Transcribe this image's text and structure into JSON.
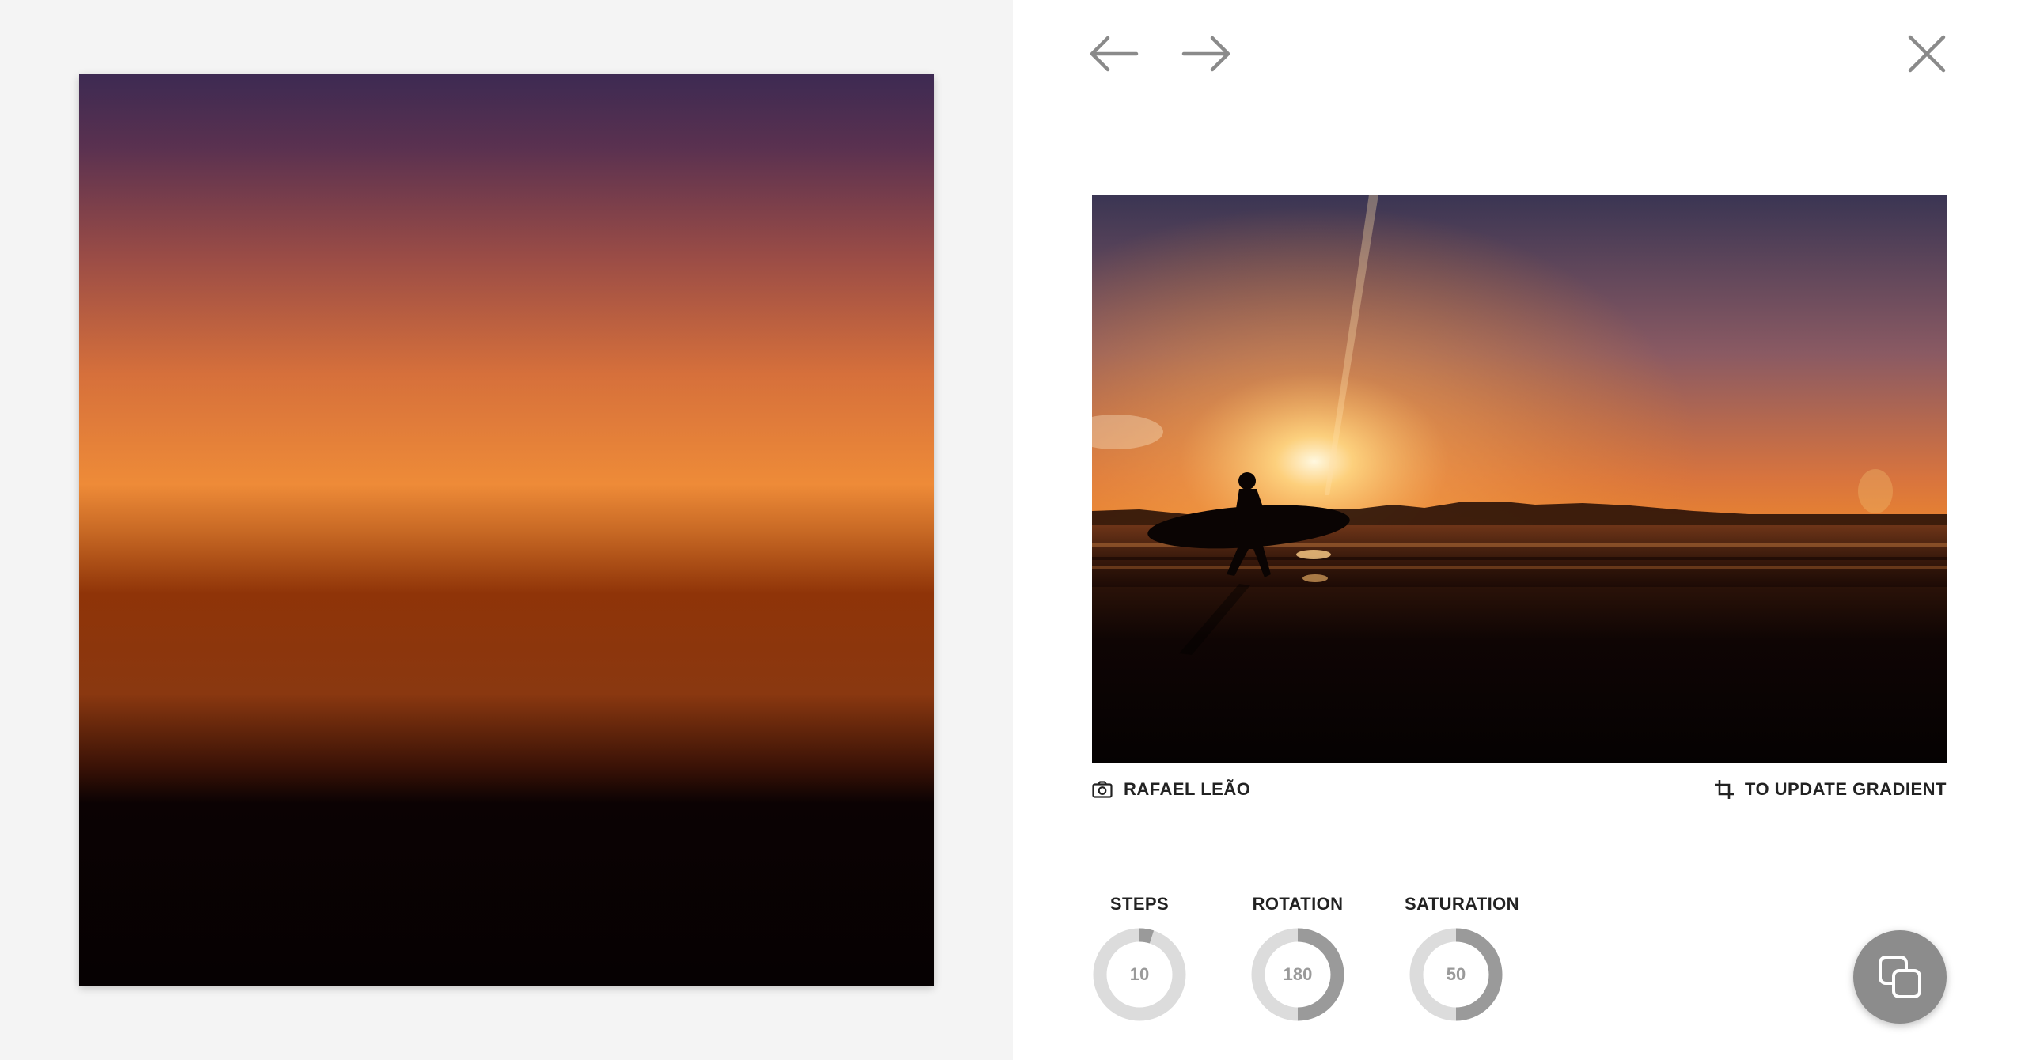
{
  "gradient": {
    "stops": [
      {
        "offset": 0.0,
        "color": "#3d2a52"
      },
      {
        "offset": 0.08,
        "color": "#5a3150"
      },
      {
        "offset": 0.2,
        "color": "#9a4c46"
      },
      {
        "offset": 0.33,
        "color": "#d6703b"
      },
      {
        "offset": 0.45,
        "color": "#ee8b38"
      },
      {
        "offset": 0.5,
        "color": "#c96a25"
      },
      {
        "offset": 0.57,
        "color": "#8f3408"
      },
      {
        "offset": 0.68,
        "color": "#8a3810"
      },
      {
        "offset": 0.76,
        "color": "#3a1206"
      },
      {
        "offset": 0.8,
        "color": "#0b0203"
      },
      {
        "offset": 1.0,
        "color": "#060102"
      }
    ]
  },
  "nav": {
    "back_icon": "arrow-left-icon",
    "forward_icon": "arrow-right-icon",
    "close_icon": "close-icon"
  },
  "photo": {
    "subject": "surfer silhouette at sunset"
  },
  "credit": {
    "icon": "camera-icon",
    "label": "RAFAEL LEÃO"
  },
  "update": {
    "icon": "crop-icon",
    "label": "TO UPDATE GRADIENT"
  },
  "controls": [
    {
      "label": "STEPS",
      "value": "10",
      "fraction": 0.05
    },
    {
      "label": "ROTATION",
      "value": "180",
      "fraction": 0.5
    },
    {
      "label": "SATURATION",
      "value": "50",
      "fraction": 0.5
    }
  ],
  "fab": {
    "icon": "copy-icon"
  },
  "colors": {
    "icon_gray": "#8a8a8a",
    "dial_track": "#dcdcdc",
    "dial_fill": "#9a9a9a",
    "fab_bg": "#8c8c8c"
  }
}
